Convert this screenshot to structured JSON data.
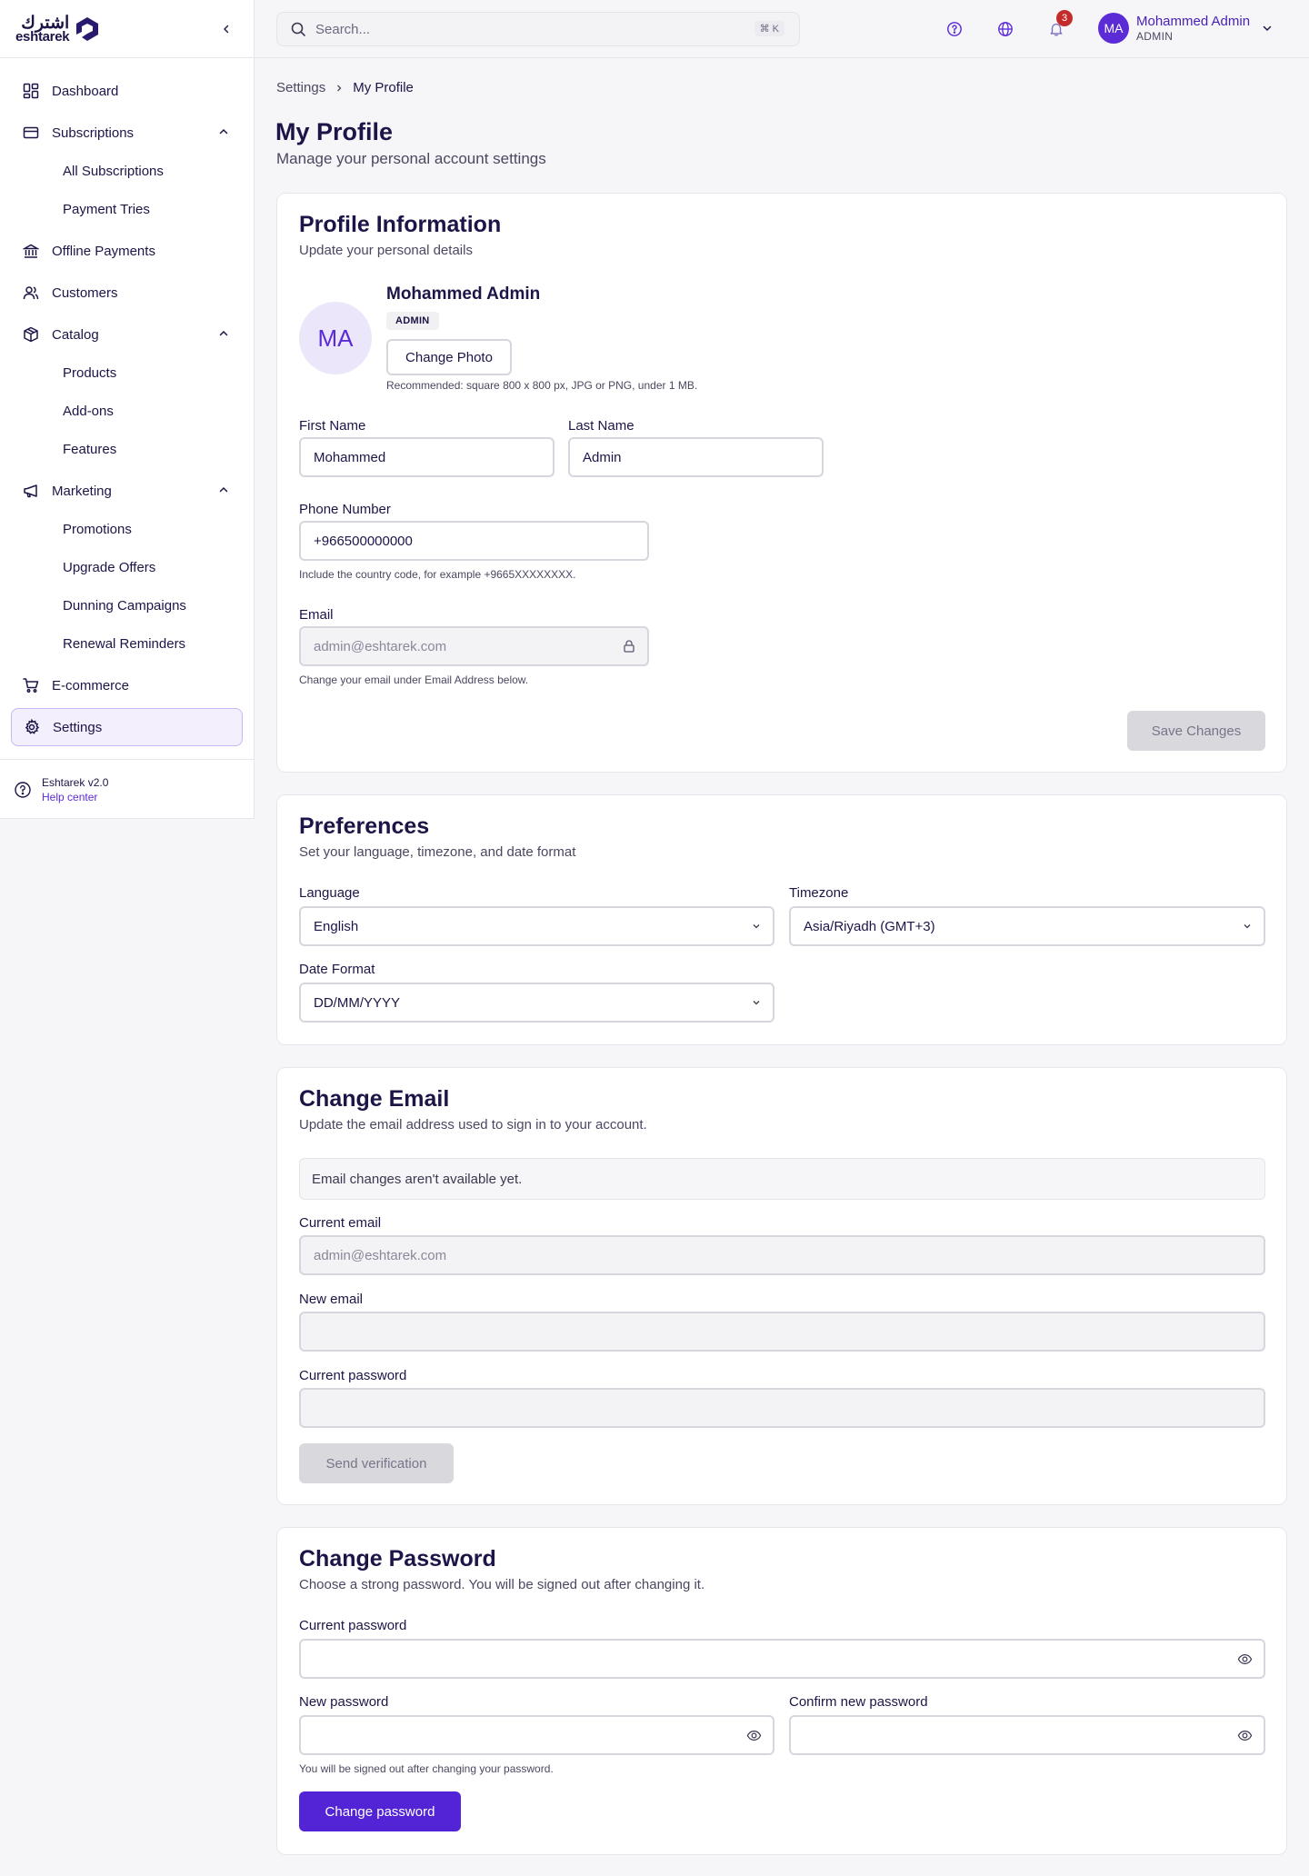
{
  "app": {
    "logo_arabic": "اشترك",
    "logo_text": "eshtarek"
  },
  "colors": {
    "brand": "#5224d6",
    "brand_text": "#4a21b8",
    "text": "#1c1547",
    "badge": "#c42b2b",
    "active_bg": "#f3effd"
  },
  "sidebar": {
    "items": [
      {
        "label": "Dashboard",
        "icon": "dashboard-grid-icon"
      },
      {
        "label": "Subscriptions",
        "icon": "credit-card-icon",
        "expanded": true,
        "children": [
          "All Subscriptions",
          "Payment Tries"
        ]
      },
      {
        "label": "Offline Payments",
        "icon": "bank-icon"
      },
      {
        "label": "Customers",
        "icon": "users-icon"
      },
      {
        "label": "Catalog",
        "icon": "package-icon",
        "expanded": true,
        "children": [
          "Products",
          "Add-ons",
          "Features"
        ]
      },
      {
        "label": "Marketing",
        "icon": "megaphone-icon",
        "expanded": true,
        "children": [
          "Promotions",
          "Upgrade Offers",
          "Dunning Campaigns",
          "Renewal Reminders"
        ]
      },
      {
        "label": "E-commerce",
        "icon": "cart-icon"
      },
      {
        "label": "Settings",
        "icon": "gear-icon",
        "active": true
      }
    ],
    "footer": {
      "version": "Eshtarek v2.0",
      "help": "Help center"
    }
  },
  "topbar": {
    "search_placeholder": "Search...",
    "shortcut": "⌘ K",
    "notification_count": "3",
    "user_initials": "MA",
    "user_name": "Mohammed Admin",
    "user_role": "ADMIN"
  },
  "breadcrumb": [
    "Settings",
    "My Profile"
  ],
  "page": {
    "title": "My Profile",
    "subtitle": "Manage your personal account settings"
  },
  "profile": {
    "title": "Profile Information",
    "subtitle": "Update your personal details",
    "initials": "MA",
    "name": "Mohammed Admin",
    "role": "ADMIN",
    "change_photo": "Change Photo",
    "photo_hint": "Recommended: square 800 x 800 px, JPG or PNG, under 1 MB.",
    "first_name_label": "First Name",
    "first_name": "Mohammed",
    "last_name_label": "Last Name",
    "last_name": "Admin",
    "phone_label": "Phone Number",
    "phone": "+966500000000",
    "phone_hint": "Include the country code, for example +9665XXXXXXXX.",
    "email_label": "Email",
    "email": "admin@eshtarek.com",
    "email_hint": "Change your email under Email Address below.",
    "save": "Save Changes"
  },
  "preferences": {
    "title": "Preferences",
    "subtitle": "Set your language, timezone, and date format",
    "language_label": "Language",
    "language": "English",
    "timezone_label": "Timezone",
    "timezone": "Asia/Riyadh (GMT+3)",
    "date_format_label": "Date Format",
    "date_format": "DD/MM/YYYY"
  },
  "change_email": {
    "title": "Change Email",
    "subtitle": "Update the email address used to sign in to your account.",
    "notice": "Email changes aren't available yet.",
    "current_email_label": "Current email",
    "current_email": "admin@eshtarek.com",
    "new_email_label": "New email",
    "new_email": "",
    "current_password_label": "Current password",
    "send": "Send verification"
  },
  "change_password": {
    "title": "Change Password",
    "subtitle": "Choose a strong password. You will be signed out after changing it.",
    "current_password_label": "Current password",
    "new_password_label": "New password",
    "confirm_password_label": "Confirm new password",
    "hint": "You will be signed out after changing your password.",
    "submit": "Change password"
  }
}
